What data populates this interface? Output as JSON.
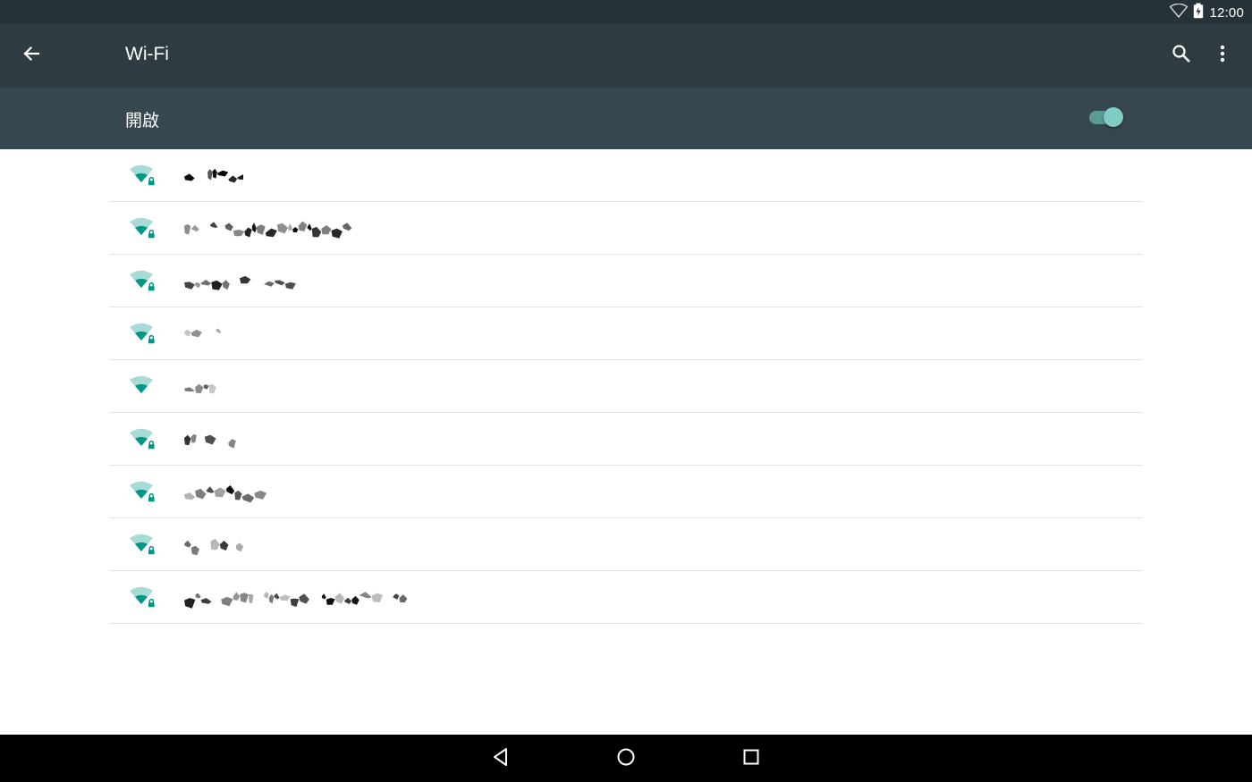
{
  "status_bar": {
    "time": "12:00"
  },
  "toolbar": {
    "title": "Wi-Fi"
  },
  "wifi_switch": {
    "label": "開啟",
    "on": true
  },
  "networks": [
    {
      "secured": true,
      "ssid_visible": false
    },
    {
      "secured": true,
      "ssid_visible": false
    },
    {
      "secured": true,
      "ssid_visible": false
    },
    {
      "secured": true,
      "ssid_visible": false
    },
    {
      "secured": false,
      "ssid_visible": false
    },
    {
      "secured": true,
      "ssid_visible": false
    },
    {
      "secured": true,
      "ssid_visible": false
    },
    {
      "secured": true,
      "ssid_visible": false
    },
    {
      "secured": true,
      "ssid_visible": false
    }
  ],
  "icons": {
    "back": "arrow-back-icon",
    "search": "search-icon",
    "more": "more-vert-icon",
    "wifi": "wifi-signal-icon",
    "lock": "lock-icon",
    "nav_back": "triangle-back-icon",
    "nav_home": "circle-home-icon",
    "nav_recents": "square-recents-icon"
  },
  "colors": {
    "status_bar": "#263238",
    "toolbar": "#2e3b40",
    "switch_bar": "#37474f",
    "accent": "#009688",
    "toggle_thumb": "#80cbc4"
  }
}
